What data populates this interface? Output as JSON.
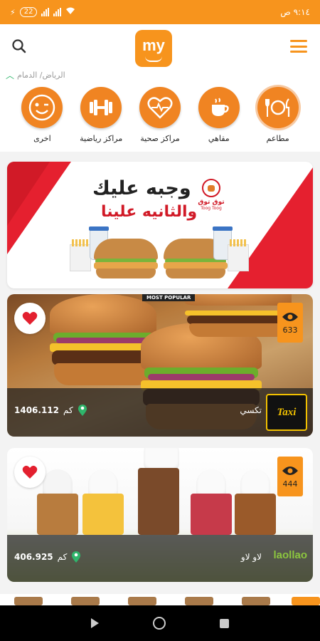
{
  "status_bar": {
    "time": "٩:١٤ ص",
    "battery": "22"
  },
  "header": {
    "logo_text": "my"
  },
  "location": {
    "text": "الرياض/ الدمام"
  },
  "categories": [
    {
      "label": "مطاعم",
      "icon": "restaurant-icon"
    },
    {
      "label": "مقاهي",
      "icon": "coffee-icon"
    },
    {
      "label": "مراكز صحية",
      "icon": "heart-icon"
    },
    {
      "label": "مراكز رياضية",
      "icon": "dumbbell-icon"
    },
    {
      "label": "اخرى",
      "icon": "wink-icon"
    }
  ],
  "banner": {
    "line1": "وجبه عليك",
    "line2": "والثانيه علينا",
    "brand_name": "توق توق",
    "brand_sub": "Toog Toog"
  },
  "cards": [
    {
      "name": "تكسي",
      "distance": "1406.112",
      "unit": "كم",
      "views": "633",
      "tag": "MOST POPULAR",
      "brand_logo": "Taxi",
      "favorited": true
    },
    {
      "name": "لاو لاو",
      "distance": "406.925",
      "unit": "كم",
      "views": "444",
      "brand_logo": "laollao",
      "favorited": true
    }
  ],
  "colors": {
    "primary": "#f7941d",
    "accent_green": "#2fb56b",
    "heart_red": "#e3202f"
  }
}
